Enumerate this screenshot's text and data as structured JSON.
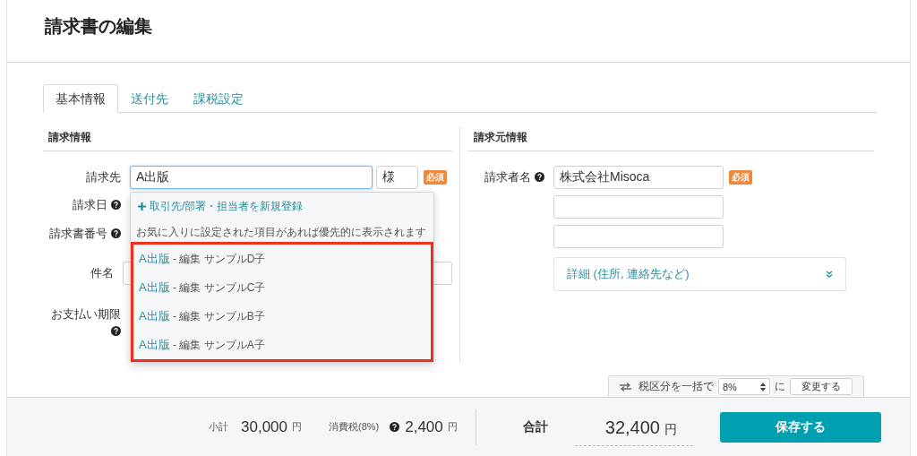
{
  "title": "請求書の編集",
  "tabs": [
    {
      "label": "基本情報",
      "selected": true
    },
    {
      "label": "送付先",
      "selected": false
    },
    {
      "label": "課税設定",
      "selected": false
    }
  ],
  "billing": {
    "heading": "請求情報",
    "fields": [
      {
        "kind": "customer",
        "label": "請求先",
        "help": false,
        "value": "A出版",
        "focused": true,
        "suffix": "様",
        "required_badge": "必須"
      },
      {
        "kind": "plain",
        "label": "請求日",
        "help": true
      },
      {
        "kind": "plain",
        "label": "請求書番号",
        "help": true
      },
      {
        "kind": "input",
        "label": "件名",
        "help": false
      },
      {
        "kind": "plain",
        "label": "お支払い期限",
        "help": true
      }
    ]
  },
  "customer_dropdown": {
    "add_new": "取引先/部署・担当者を新規登録",
    "hint": "お気に入りに設定された項目があれば優先的に表示されます",
    "highlighted": true,
    "suggestions": [
      {
        "name": "A出版",
        "detail": "- 編集 サンプルD子"
      },
      {
        "name": "A出版",
        "detail": "- 編集 サンプルC子"
      },
      {
        "name": "A出版",
        "detail": "- 編集 サンプルB子"
      },
      {
        "name": "A出版",
        "detail": "- 編集 サンプルA子"
      }
    ]
  },
  "issuer": {
    "heading": "請求元情報",
    "label": "請求者名",
    "help": true,
    "required_badge": "必須",
    "inputs": [
      {
        "kind": "filled",
        "value": "株式会社Misoca"
      },
      {
        "kind": "empty"
      },
      {
        "kind": "empty"
      }
    ],
    "details_toggle": "詳細 (住所, 連絡先など)"
  },
  "tax_bar": {
    "label": "税区分を一括で",
    "rate": "8%",
    "suffix": "に",
    "button": "変更する"
  },
  "footer": {
    "subtotal_label": "小計",
    "subtotal": "30,000",
    "subtotal_unit": "円",
    "tax_label": "消費税(8%)",
    "tax_help": true,
    "tax": "2,400",
    "tax_unit": "円",
    "total_label": "合計",
    "total": "32,400",
    "total_unit": "円",
    "save_button": "保存する"
  }
}
